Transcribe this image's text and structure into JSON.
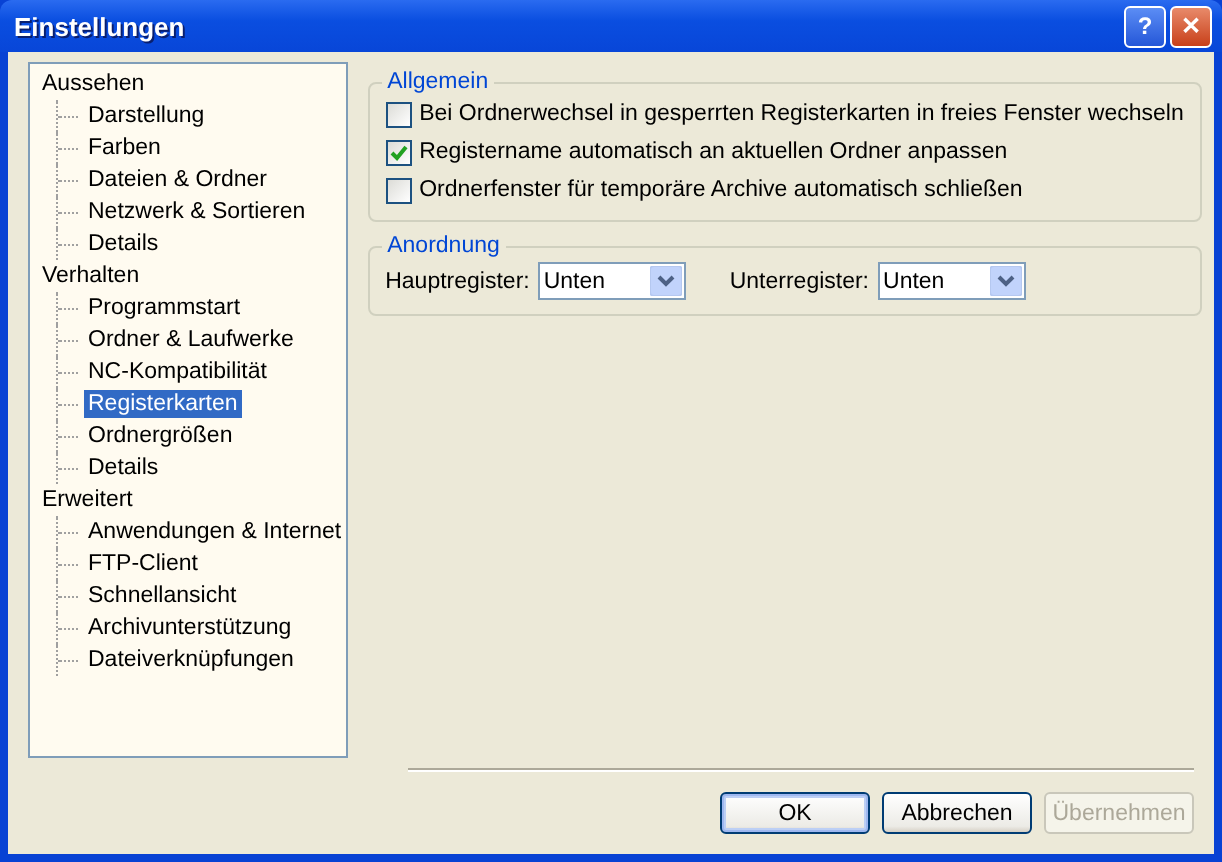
{
  "window": {
    "title": "Einstellungen",
    "title_buttons": [
      {
        "kind": "help",
        "label": "?"
      },
      {
        "kind": "close",
        "label": "✕"
      }
    ]
  },
  "tree": [
    {
      "label": "Aussehen",
      "selected": false,
      "children": [
        {
          "label": "Darstellung",
          "selected": false
        },
        {
          "label": "Farben",
          "selected": false
        },
        {
          "label": "Dateien & Ordner",
          "selected": false
        },
        {
          "label": "Netzwerk & Sortieren",
          "selected": false
        },
        {
          "label": "Details",
          "selected": false
        }
      ]
    },
    {
      "label": "Verhalten",
      "selected": false,
      "children": [
        {
          "label": "Programmstart",
          "selected": false
        },
        {
          "label": "Ordner & Laufwerke",
          "selected": false
        },
        {
          "label": "NC-Kompatibilität",
          "selected": false
        },
        {
          "label": "Registerkarten",
          "selected": true
        },
        {
          "label": "Ordnergrößen",
          "selected": false
        },
        {
          "label": "Details",
          "selected": false
        }
      ]
    },
    {
      "label": "Erweitert",
      "selected": false,
      "children": [
        {
          "label": "Anwendungen & Internet",
          "selected": false
        },
        {
          "label": "FTP-Client",
          "selected": false
        },
        {
          "label": "Schnellansicht",
          "selected": false
        },
        {
          "label": "Archivunterstützung",
          "selected": false
        },
        {
          "label": "Dateiverknüpfungen",
          "selected": false
        }
      ]
    }
  ],
  "groups": [
    {
      "title": "Allgemein",
      "kind": "checkboxes",
      "items": [
        {
          "label": "Bei Ordnerwechsel in gesperrten Registerkarten in freies Fenster wechseln",
          "checked": false
        },
        {
          "label": "Registername automatisch an aktuellen Ordner anpassen",
          "checked": true
        },
        {
          "label": "Ordnerfenster für temporäre Archive automatisch schließen",
          "checked": false
        }
      ]
    },
    {
      "title": "Anordnung",
      "kind": "selects",
      "items": [
        {
          "label": "Hauptregister:",
          "value": "Unten"
        },
        {
          "label": "Unterregister:",
          "value": "Unten"
        }
      ]
    }
  ],
  "buttons": [
    {
      "label": "OK",
      "default": true,
      "disabled": false
    },
    {
      "label": "Abbrechen",
      "default": false,
      "disabled": false
    },
    {
      "label": "Übernehmen",
      "default": false,
      "disabled": true
    }
  ]
}
